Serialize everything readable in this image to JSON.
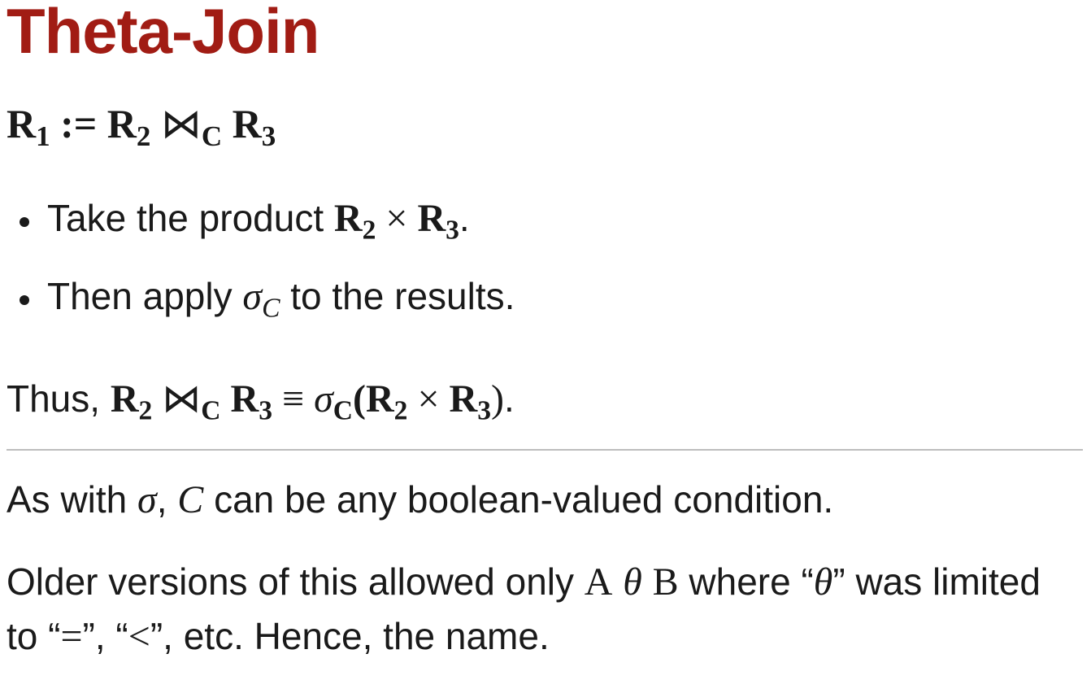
{
  "title": "Theta-Join",
  "definition": {
    "lhs": "R",
    "lhs_sub": "1",
    "assign": " := ",
    "r2": "R",
    "r2_sub": "2",
    "join_symbol": "⋈",
    "cond": "C",
    "r3": "R",
    "r3_sub": "3"
  },
  "bullets": [
    {
      "prefix": "Take the product ",
      "r2": "R",
      "r2_sub": "2",
      "times": " × ",
      "r3": "R",
      "r3_sub": "3",
      "suffix": "."
    },
    {
      "prefix": "Then apply ",
      "sigma": "σ",
      "sigma_sub": "C",
      "suffix": " to the results."
    }
  ],
  "thus": {
    "prefix": "Thus, ",
    "r2": "R",
    "r2_sub": "2",
    "join_symbol": "⋈",
    "cond": "C",
    "r3": "R",
    "r3_sub": "3",
    "equiv": " ≡ ",
    "sigma": "σ",
    "sigma_sub": "C",
    "open": "(",
    "r2b": "R",
    "r2b_sub": "2",
    "times": " × ",
    "r3b": "R",
    "r3b_sub": "3",
    "close": ")",
    "suffix": "."
  },
  "para1": {
    "prefix": "As with ",
    "sigma": "σ",
    "comma": ", ",
    "cond": "C",
    "suffix": " can be any boolean-valued condition."
  },
  "para2": {
    "prefix": "Older versions of this allowed only ",
    "a": "A",
    "theta": "θ",
    "b": "B",
    "mid1": " where “",
    "theta2": "θ",
    "mid2": "” was limited to “",
    "eq": "=",
    "mid3": "”, “",
    "lt": "<",
    "suffix": "”, etc. Hence, the name."
  }
}
